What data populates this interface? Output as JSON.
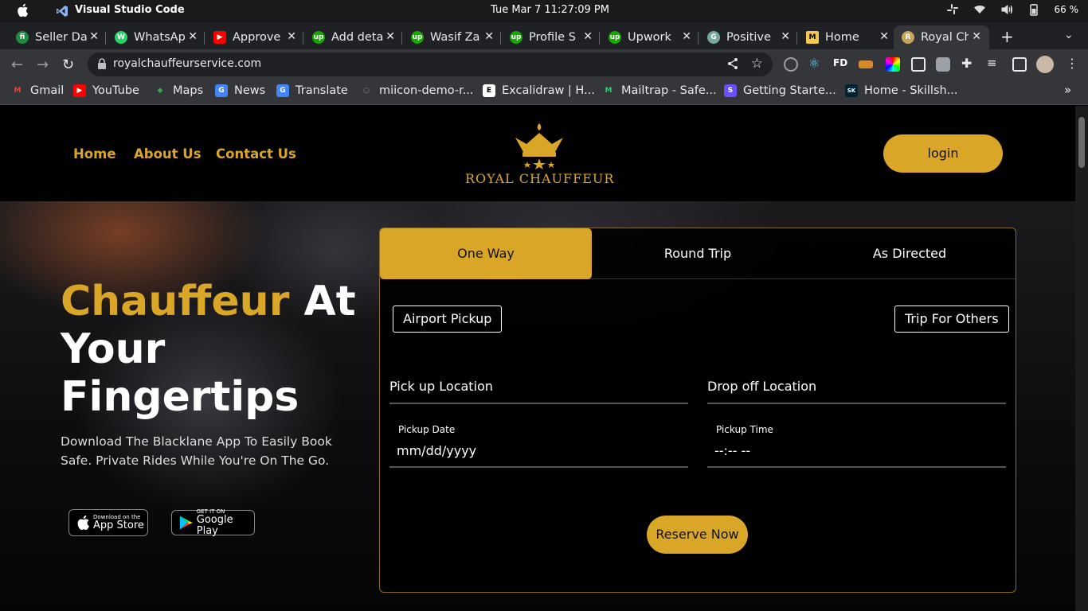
{
  "os": {
    "app_name": "Visual Studio Code",
    "clock": "Tue Mar 7  11:27:09 PM",
    "battery": "66 %"
  },
  "browser": {
    "tabs": [
      {
        "title": "Seller Da",
        "color": "#1e8e3e",
        "letter": "fi"
      },
      {
        "title": "WhatsAp",
        "color": "#25d366",
        "letter": "W"
      },
      {
        "title": "Approve",
        "color": "#ff0000",
        "letter": "▶"
      },
      {
        "title": "Add deta",
        "color": "#14a800",
        "letter": "up"
      },
      {
        "title": "Wasif Za",
        "color": "#14a800",
        "letter": "up"
      },
      {
        "title": "Profile S",
        "color": "#14a800",
        "letter": "up"
      },
      {
        "title": "Upwork",
        "color": "#14a800",
        "letter": "up"
      },
      {
        "title": "Positive",
        "color": "#74aa9c",
        "letter": "G"
      },
      {
        "title": "Home",
        "color": "#f2c94c",
        "letter": "M"
      },
      {
        "title": "Royal Ch",
        "color": "#c8a45a",
        "letter": "R"
      }
    ],
    "url": "royalchauffeurservice.com",
    "bookmarks": [
      {
        "title": "Gmail",
        "color": "#ea4335",
        "letter": "M"
      },
      {
        "title": "YouTube",
        "color": "#ff0000",
        "letter": "▶"
      },
      {
        "title": "Maps",
        "color": "#34a853",
        "letter": "◆"
      },
      {
        "title": "News",
        "color": "#4285f4",
        "letter": "G"
      },
      {
        "title": "Translate",
        "color": "#4285f4",
        "letter": "G"
      },
      {
        "title": "miicon-demo-r...",
        "color": "#333333",
        "letter": "○"
      },
      {
        "title": "Excalidraw | H...",
        "color": "#ffffff",
        "letter": "E"
      },
      {
        "title": "Mailtrap - Safe...",
        "color": "#22d172",
        "letter": "M"
      },
      {
        "title": "Getting Starte...",
        "color": "#6b4eff",
        "letter": "S"
      },
      {
        "title": "Home - Skillsh...",
        "color": "#002333",
        "letter": "SK"
      }
    ]
  },
  "site": {
    "nav": {
      "home": "Home",
      "about": "About Us",
      "contact": "Contact Us",
      "login": "login"
    },
    "logo_text": "ROYAL CHAUFFEUR",
    "hero": {
      "headline_gold": "Chauffeur",
      "headline_white_1": "At",
      "headline_white_2": "Your",
      "headline_white_3": "Fingertips",
      "subtext": "Download The Blacklane App To Easily Book Safe. Private Rides While You're On The Go.",
      "appstore_small": "Download on the",
      "appstore_big": "App Store",
      "googleplay_small": "GET IT ON",
      "googleplay_big": "Google Play"
    },
    "booking": {
      "tabs": [
        "One Way",
        "Round Trip",
        "As Directed"
      ],
      "active_tab": "One Way",
      "airport_pickup": "Airport Pickup",
      "trip_for_others": "Trip For Others",
      "pickup_location": "Pick up Location",
      "dropoff_location": "Drop off Location",
      "pickup_date_label": "Pickup Date",
      "pickup_date_value": "mm/dd/yyyy",
      "pickup_time_label": "Pickup Time",
      "pickup_time_value": "--:-- --",
      "reserve": "Reserve Now"
    },
    "colors": {
      "accent": "#d9a628"
    }
  }
}
